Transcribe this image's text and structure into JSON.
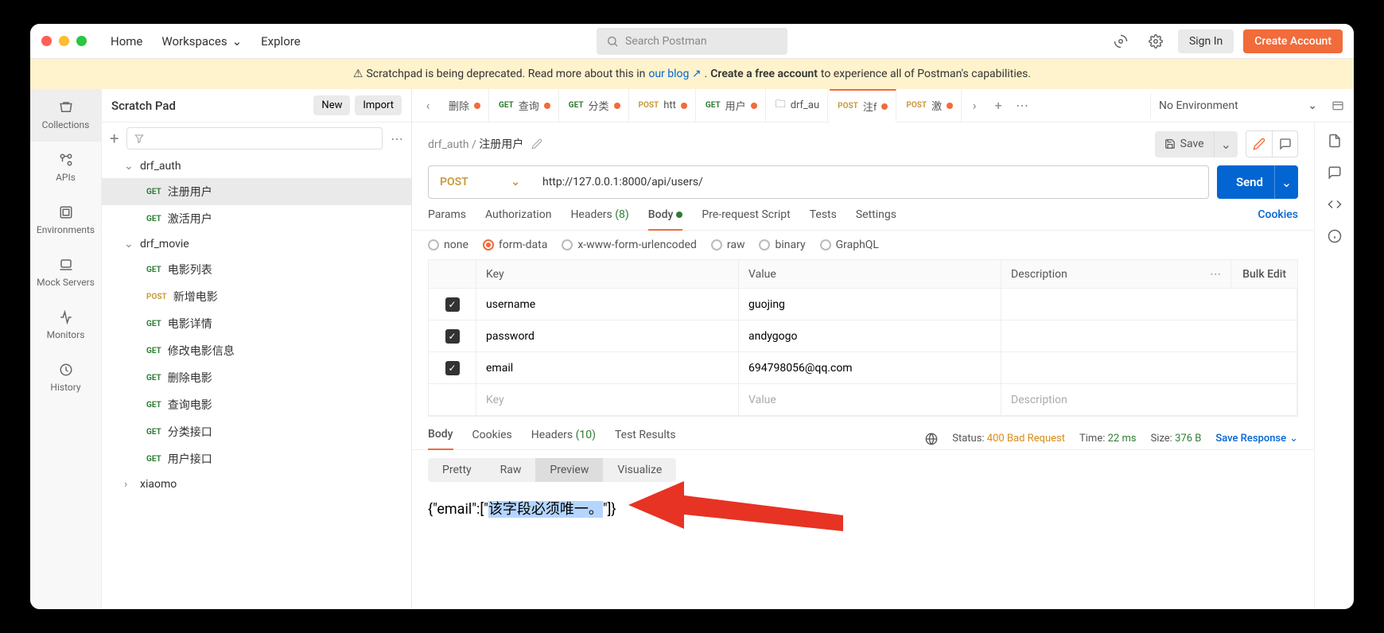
{
  "topnav": {
    "home": "Home",
    "workspaces": "Workspaces",
    "explore": "Explore"
  },
  "search_placeholder": "Search Postman",
  "auth": {
    "signin": "Sign In",
    "create": "Create Account"
  },
  "deprecation": {
    "prefix": "Scratchpad is being deprecated. Read more about this in ",
    "blog_link": "our blog",
    "between": ". ",
    "strong": "Create a free account",
    "suffix": " to experience all of Postman's capabilities."
  },
  "rail": {
    "collections": "Collections",
    "apis": "APIs",
    "environments": "Environments",
    "mock": "Mock Servers",
    "monitors": "Monitors",
    "history": "History"
  },
  "sidebar": {
    "title": "Scratch Pad",
    "new": "New",
    "import": "Import",
    "folders": [
      {
        "name": "drf_auth",
        "items": [
          {
            "method": "GET",
            "label": "注册用户"
          },
          {
            "method": "GET",
            "label": "激活用户"
          }
        ]
      },
      {
        "name": "drf_movie",
        "items": [
          {
            "method": "GET",
            "label": "电影列表"
          },
          {
            "method": "POST",
            "label": "新增电影"
          },
          {
            "method": "GET",
            "label": "电影详情"
          },
          {
            "method": "GET",
            "label": "修改电影信息"
          },
          {
            "method": "GET",
            "label": "删除电影"
          },
          {
            "method": "GET",
            "label": "查询电影"
          },
          {
            "method": "GET",
            "label": "分类接口"
          },
          {
            "method": "GET",
            "label": "用户接口"
          }
        ]
      },
      {
        "name": "xiaomo",
        "items": []
      }
    ]
  },
  "tabs": [
    {
      "method": "",
      "label": "删除",
      "dot": true
    },
    {
      "method": "GET",
      "label": "查询",
      "dot": true
    },
    {
      "method": "GET",
      "label": "分类",
      "dot": true
    },
    {
      "method": "POST",
      "label": "htt",
      "dot": true
    },
    {
      "method": "GET",
      "label": "用户",
      "dot": true
    },
    {
      "method": "",
      "label": "drf_au",
      "dot": false,
      "icon": "folder"
    },
    {
      "method": "POST",
      "label": "注f",
      "dot": true,
      "active": true
    },
    {
      "method": "POST",
      "label": "激",
      "dot": true
    }
  ],
  "env": "No Environment",
  "breadcrumb": {
    "parent": "drf_auth",
    "current": "注册用户"
  },
  "save": "Save",
  "request": {
    "method": "POST",
    "url": "http://127.0.0.1:8000/api/users/"
  },
  "send": "Send",
  "req_tabs": {
    "params": "Params",
    "auth": "Authorization",
    "headers": "Headers",
    "headers_count": "(8)",
    "body": "Body",
    "prerequest": "Pre-request Script",
    "tests": "Tests",
    "settings": "Settings",
    "cookies": "Cookies"
  },
  "body_types": [
    "none",
    "form-data",
    "x-www-form-urlencoded",
    "raw",
    "binary",
    "GraphQL"
  ],
  "table": {
    "headers": {
      "key": "Key",
      "value": "Value",
      "desc": "Description",
      "bulk": "Bulk Edit"
    },
    "rows": [
      {
        "key": "username",
        "value": "guojing",
        "desc": ""
      },
      {
        "key": "password",
        "value": "andygogo",
        "desc": ""
      },
      {
        "key": "email",
        "value": "694798056@qq.com",
        "desc": ""
      }
    ],
    "placeholder": {
      "key": "Key",
      "value": "Value",
      "desc": "Description"
    }
  },
  "response": {
    "tabs": {
      "body": "Body",
      "cookies": "Cookies",
      "headers": "Headers",
      "headers_count": "(10)",
      "tests": "Test Results"
    },
    "status": {
      "label": "Status:",
      "code": "400",
      "text": "Bad Request"
    },
    "time": {
      "label": "Time:",
      "value": "22 ms"
    },
    "size": {
      "label": "Size:",
      "value": "376 B"
    },
    "save": "Save Response",
    "views": [
      "Pretty",
      "Raw",
      "Preview",
      "Visualize"
    ],
    "body_prefix": "{\"email\":[\"",
    "body_highlight": "该字段必须唯一。",
    "body_suffix": "\"]}"
  }
}
